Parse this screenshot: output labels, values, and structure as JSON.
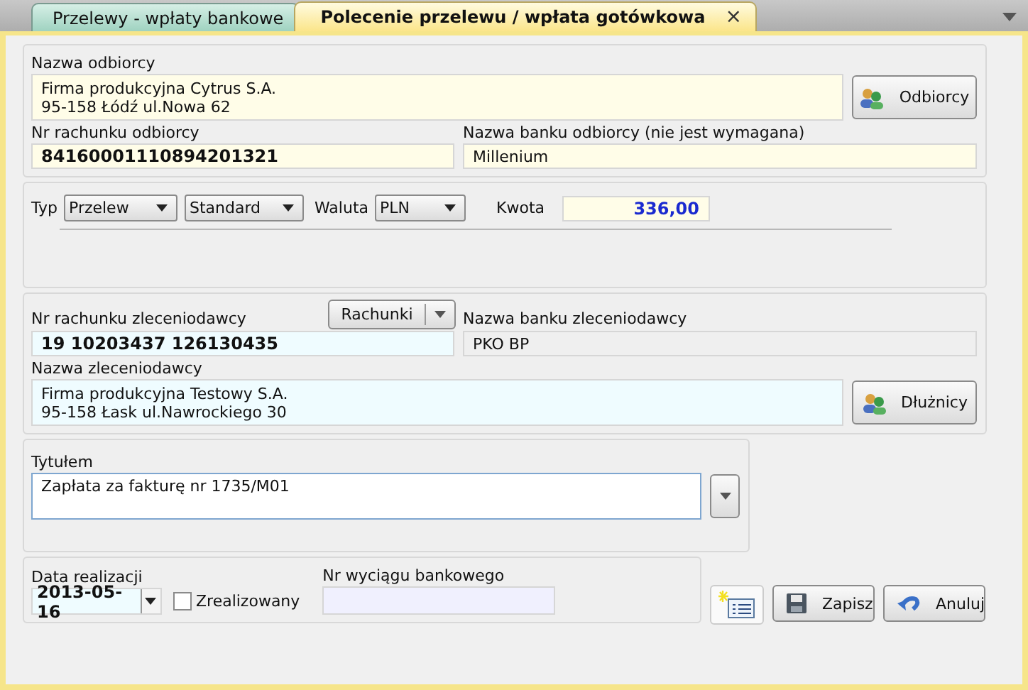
{
  "tabs": [
    {
      "label": "Przelewy - wpłaty bankowe",
      "selected": false
    },
    {
      "label": "Polecenie przelewu / wpłata gotówkowa",
      "selected": true,
      "close": "×"
    }
  ],
  "recipient": {
    "name_label": "Nazwa odbiorcy",
    "name_value": "Firma produkcyjna Cytrus S.A.\n95-158 Łódź ul.Nowa 62",
    "button": "Odbiorcy",
    "account_label": "Nr rachunku odbiorcy",
    "account_value": "84160001110894201321",
    "bank_label": "Nazwa banku odbiorcy (nie jest wymagana)",
    "bank_value": "Millenium"
  },
  "transfer": {
    "type_label": "Typ",
    "type_value": "Przelew",
    "mode_value": "Standard",
    "currency_label": "Waluta",
    "currency_value": "PLN",
    "amount_label": "Kwota",
    "amount_value": "336,00"
  },
  "payer": {
    "account_label": "Nr rachunku zleceniodawcy",
    "accounts_button": "Rachunki",
    "bank_label": "Nazwa banku zleceniodawcy",
    "account_value": "19 10203437 126130435",
    "bank_value": "PKO BP",
    "name_label": "Nazwa zleceniodawcy",
    "name_value": "Firma produkcyjna Testowy S.A.\n95-158 Łask ul.Nawrockiego 30",
    "button": "Dłużnicy"
  },
  "title": {
    "label": "Tytułem",
    "value": "Zapłata za fakturę nr 1735/M01"
  },
  "execution": {
    "date_label": "Data realizacji",
    "date_value": "2013-05-16",
    "done_label": "Zrealizowany",
    "done_checked": false,
    "statement_label": "Nr wyciągu bankowego"
  },
  "buttons": {
    "save": "Zapisz",
    "cancel": "Anuluj"
  }
}
